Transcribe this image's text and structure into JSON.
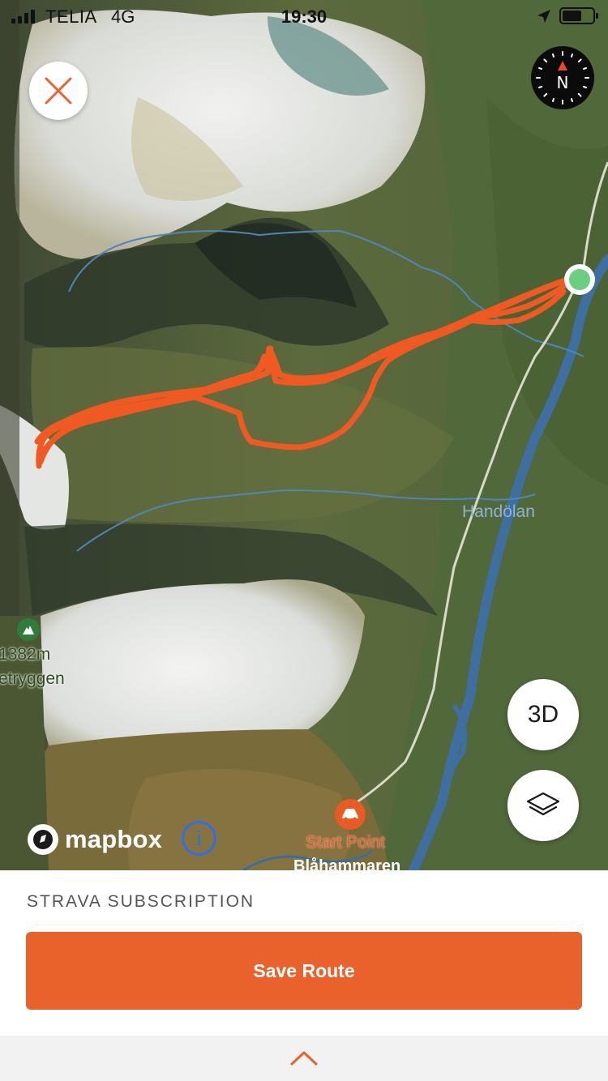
{
  "status_bar": {
    "carrier": "TELIA",
    "network": "4G",
    "time": "19:30",
    "battery_level": 0.65
  },
  "map": {
    "compass_label": "N",
    "places": {
      "handolan": "Handölan",
      "peak_elevation": "1382m",
      "peak_name": "etryggen",
      "start_point": "Start Point",
      "blahammaren": "Blåhammaren"
    },
    "controls": {
      "three_d_label": "3D",
      "layers_icon": "layers-icon",
      "close_icon": "close-icon"
    },
    "attribution": {
      "logo_text": "mapbox",
      "info_icon": "i"
    },
    "route_color": "#f05a22",
    "start_marker_color": "#6bcf7f"
  },
  "panel": {
    "subscription_label": "STRAVA SUBSCRIPTION",
    "save_button_label": "Save Route",
    "accent_color": "#e9612b",
    "drawer_icon": "chevron-up-icon"
  }
}
